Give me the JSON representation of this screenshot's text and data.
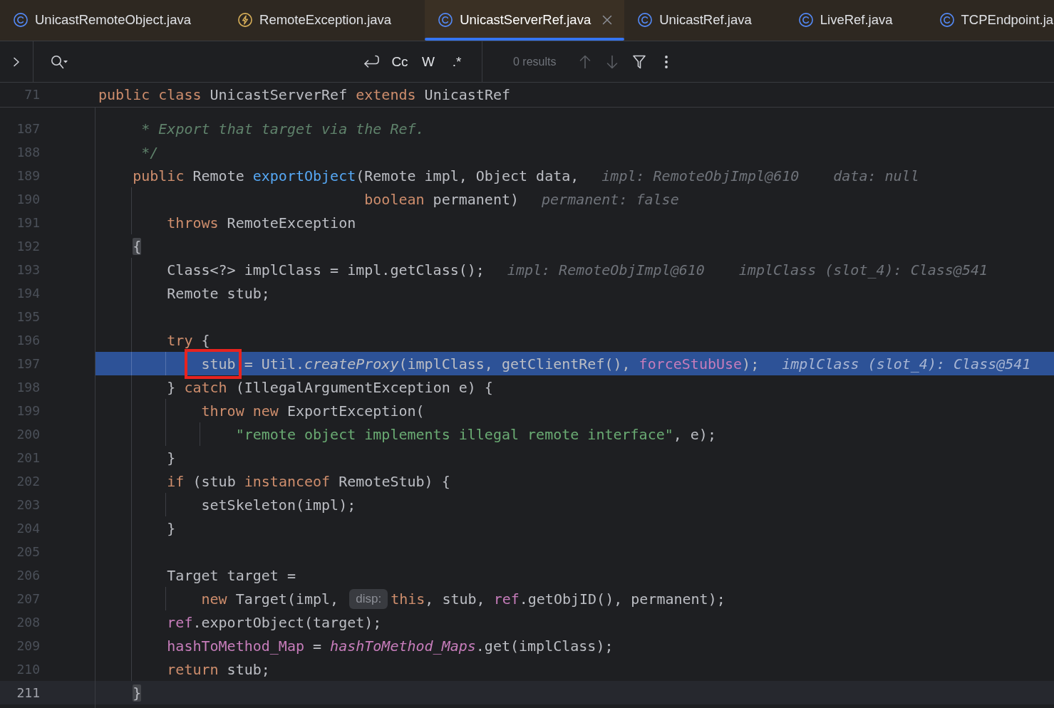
{
  "tabs": [
    {
      "label": "UnicastRemoteObject.java",
      "kind": "class",
      "selected": false
    },
    {
      "label": "RemoteException.java",
      "kind": "exception",
      "selected": false
    },
    {
      "label": "UnicastServerRef.java",
      "kind": "class",
      "selected": true
    },
    {
      "label": "UnicastRef.java",
      "kind": "class",
      "selected": false
    },
    {
      "label": "LiveRef.java",
      "kind": "class",
      "selected": false
    },
    {
      "label": "TCPEndpoint.ja",
      "kind": "class",
      "selected": false
    }
  ],
  "find_bar": {
    "expanded": false,
    "options": [
      {
        "kind": "newline",
        "selected": false
      },
      {
        "kind": "text",
        "label": "Cc",
        "selected": false
      },
      {
        "kind": "text",
        "label": "W",
        "selected": false
      },
      {
        "kind": "text",
        "label": ".*",
        "selected": false
      }
    ],
    "results": "0 results",
    "actions": [
      {
        "kind": "previous",
        "disabled": true
      },
      {
        "kind": "next",
        "disabled": true
      },
      {
        "kind": "filter",
        "disabled": false
      },
      {
        "kind": "more",
        "disabled": false
      }
    ]
  },
  "editor": {
    "sticky_line": {
      "number": "71",
      "segments": [
        {
          "kind": "code",
          "tokens": [
            {
              "kind": "keyword",
              "text": "public class"
            },
            {
              "kind": "plain",
              "text": " UnicastServerRef "
            },
            {
              "kind": "keyword",
              "text": "extends"
            },
            {
              "kind": "plain",
              "text": " UnicastRef"
            }
          ]
        }
      ]
    },
    "lines": [
      {
        "number": "187",
        "highlighted": false,
        "current": false,
        "segments": [
          {
            "kind": "code",
            "tokens": [
              {
                "kind": "comment",
                "text": "     * Export that target via the Ref."
              }
            ]
          }
        ]
      },
      {
        "number": "188",
        "highlighted": false,
        "current": false,
        "segments": [
          {
            "kind": "code",
            "tokens": [
              {
                "kind": "comment",
                "text": "     */"
              }
            ]
          }
        ]
      },
      {
        "number": "189",
        "highlighted": false,
        "current": false,
        "segments": [
          {
            "kind": "code",
            "tokens": [
              {
                "kind": "keyword",
                "text": "    public"
              },
              {
                "kind": "plain",
                "text": " Remote "
              },
              {
                "kind": "declaration",
                "text": "exportObject"
              },
              {
                "kind": "plain",
                "text": "(Remote impl, Object data,"
              }
            ]
          },
          {
            "kind": "value-hint",
            "text": "impl: RemoteObjImpl@610"
          },
          {
            "kind": "value-hint",
            "text": "data: null"
          }
        ]
      },
      {
        "number": "190",
        "highlighted": false,
        "current": false,
        "segments": [
          {
            "kind": "code",
            "tokens": [
              {
                "kind": "keyword",
                "text": "                               boolean"
              },
              {
                "kind": "plain",
                "text": " permanent)"
              }
            ]
          },
          {
            "kind": "value-hint",
            "text": "permanent: false"
          }
        ]
      },
      {
        "number": "191",
        "highlighted": false,
        "current": false,
        "segments": [
          {
            "kind": "code",
            "tokens": [
              {
                "kind": "keyword",
                "text": "        throws"
              },
              {
                "kind": "plain",
                "text": " RemoteException"
              }
            ]
          }
        ]
      },
      {
        "number": "192",
        "highlighted": false,
        "current": false,
        "segments": [
          {
            "kind": "code",
            "tokens": [
              {
                "kind": "brace-match",
                "text": "    {"
              }
            ]
          }
        ]
      },
      {
        "number": "193",
        "highlighted": false,
        "current": false,
        "segments": [
          {
            "kind": "code",
            "tokens": [
              {
                "kind": "plain",
                "text": "        Class<?> implClass = impl.getClass();"
              }
            ]
          },
          {
            "kind": "value-hint",
            "text": "impl: RemoteObjImpl@610"
          },
          {
            "kind": "value-hint",
            "text": "implClass (slot_4): Class@541"
          }
        ]
      },
      {
        "number": "194",
        "highlighted": false,
        "current": false,
        "segments": [
          {
            "kind": "code",
            "tokens": [
              {
                "kind": "plain",
                "text": "        Remote stub;"
              }
            ]
          }
        ]
      },
      {
        "number": "195",
        "highlighted": false,
        "current": false
      },
      {
        "number": "196",
        "highlighted": false,
        "current": false,
        "segments": [
          {
            "kind": "code",
            "tokens": [
              {
                "kind": "keyword",
                "text": "        try"
              },
              {
                "kind": "plain",
                "text": " {"
              }
            ]
          }
        ]
      },
      {
        "number": "197",
        "highlighted": true,
        "current": false,
        "segments": [
          {
            "kind": "code",
            "tokens": [
              {
                "kind": "boxed",
                "text": "            stub"
              },
              {
                "kind": "plain",
                "text": " = Util."
              },
              {
                "kind": "static-call",
                "text": "createProxy"
              },
              {
                "kind": "plain",
                "text": "(implClass, getClientRef(), "
              },
              {
                "kind": "field",
                "text": "forceStubUse"
              },
              {
                "kind": "plain",
                "text": ");"
              }
            ]
          },
          {
            "kind": "value-hint",
            "text": "implClass (slot_4): Class@541"
          }
        ]
      },
      {
        "number": "198",
        "highlighted": false,
        "current": false,
        "segments": [
          {
            "kind": "code",
            "tokens": [
              {
                "kind": "plain",
                "text": "        } "
              },
              {
                "kind": "keyword",
                "text": "catch"
              },
              {
                "kind": "plain",
                "text": " (IllegalArgumentException e) {"
              }
            ]
          }
        ]
      },
      {
        "number": "199",
        "highlighted": false,
        "current": false,
        "segments": [
          {
            "kind": "code",
            "tokens": [
              {
                "kind": "keyword",
                "text": "            throw new"
              },
              {
                "kind": "plain",
                "text": " ExportException("
              }
            ]
          }
        ]
      },
      {
        "number": "200",
        "highlighted": false,
        "current": false,
        "segments": [
          {
            "kind": "code",
            "tokens": [
              {
                "kind": "string",
                "text": "                \"remote object implements illegal remote interface\""
              },
              {
                "kind": "plain",
                "text": ", e);"
              }
            ]
          }
        ]
      },
      {
        "number": "201",
        "highlighted": false,
        "current": false,
        "segments": [
          {
            "kind": "code",
            "tokens": [
              {
                "kind": "plain",
                "text": "        }"
              }
            ]
          }
        ]
      },
      {
        "number": "202",
        "highlighted": false,
        "current": false,
        "segments": [
          {
            "kind": "code",
            "tokens": [
              {
                "kind": "keyword",
                "text": "        if"
              },
              {
                "kind": "plain",
                "text": " (stub "
              },
              {
                "kind": "keyword",
                "text": "instanceof"
              },
              {
                "kind": "plain",
                "text": " RemoteStub) {"
              }
            ]
          }
        ]
      },
      {
        "number": "203",
        "highlighted": false,
        "current": false,
        "segments": [
          {
            "kind": "code",
            "tokens": [
              {
                "kind": "plain",
                "text": "            setSkeleton(impl);"
              }
            ]
          }
        ]
      },
      {
        "number": "204",
        "highlighted": false,
        "current": false,
        "segments": [
          {
            "kind": "code",
            "tokens": [
              {
                "kind": "plain",
                "text": "        }"
              }
            ]
          }
        ]
      },
      {
        "number": "205",
        "highlighted": false,
        "current": false
      },
      {
        "number": "206",
        "highlighted": false,
        "current": false,
        "segments": [
          {
            "kind": "code",
            "tokens": [
              {
                "kind": "plain",
                "text": "        Target target ="
              }
            ]
          }
        ]
      },
      {
        "number": "207",
        "highlighted": false,
        "current": false,
        "segments": [
          {
            "kind": "code",
            "tokens": [
              {
                "kind": "keyword",
                "text": "            new"
              },
              {
                "kind": "plain",
                "text": " Target(impl, "
              }
            ]
          },
          {
            "kind": "param-hint",
            "text": "disp:"
          },
          {
            "kind": "code",
            "tokens": [
              {
                "kind": "keyword",
                "text": "this"
              },
              {
                "kind": "plain",
                "text": ", stub, "
              },
              {
                "kind": "field",
                "text": "ref"
              },
              {
                "kind": "plain",
                "text": ".getObjID(), permanent);"
              }
            ]
          }
        ]
      },
      {
        "number": "208",
        "highlighted": false,
        "current": false,
        "segments": [
          {
            "kind": "code",
            "tokens": [
              {
                "kind": "field",
                "text": "        ref"
              },
              {
                "kind": "plain",
                "text": ".exportObject(target);"
              }
            ]
          }
        ]
      },
      {
        "number": "209",
        "highlighted": false,
        "current": false,
        "segments": [
          {
            "kind": "code",
            "tokens": [
              {
                "kind": "field",
                "text": "        hashToMethod_Map"
              },
              {
                "kind": "plain",
                "text": " = "
              },
              {
                "kind": "static-field",
                "text": "hashToMethod_Maps"
              },
              {
                "kind": "plain",
                "text": ".get(implClass);"
              }
            ]
          }
        ]
      },
      {
        "number": "210",
        "highlighted": false,
        "current": false,
        "segments": [
          {
            "kind": "code",
            "tokens": [
              {
                "kind": "keyword",
                "text": "        return"
              },
              {
                "kind": "plain",
                "text": " stub;"
              }
            ]
          }
        ]
      },
      {
        "number": "211",
        "highlighted": false,
        "current": true,
        "segments": [
          {
            "kind": "code",
            "tokens": [
              {
                "kind": "brace-match",
                "text": "    }"
              }
            ]
          }
        ]
      }
    ]
  }
}
